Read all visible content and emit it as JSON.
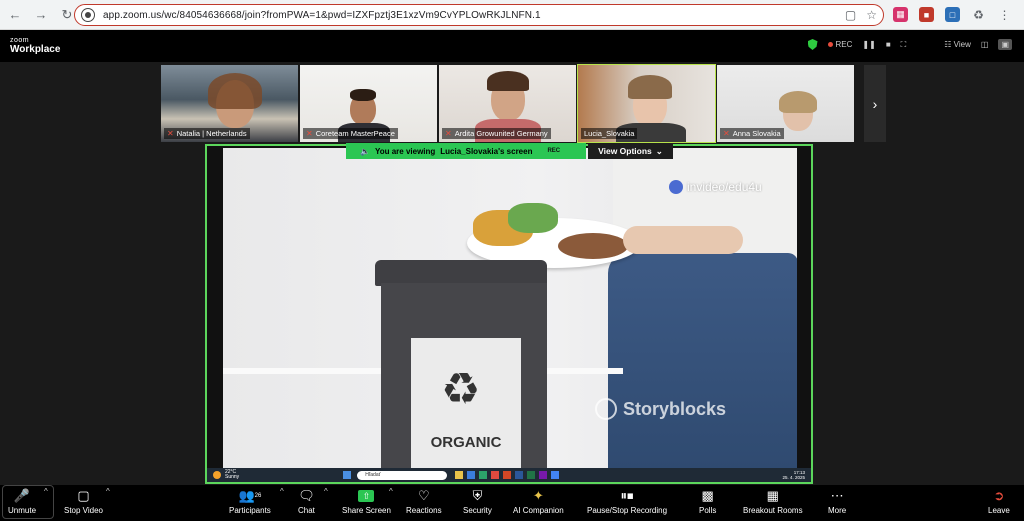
{
  "browser": {
    "url": "app.zoom.us/wc/84054636668/join?fromPWA=1&pwd=IZXFpztj3E1xzVm9CvYPLOwRKJLNFN.1"
  },
  "zoom": {
    "logo_small": "zoom",
    "logo_big": "Workplace",
    "rec_label": "REC",
    "view_label": "View"
  },
  "participants": [
    {
      "name": "Natalia | Netherlands"
    },
    {
      "name": "Coreteam MasterPeace"
    },
    {
      "name": "Ardita Growunited Germany"
    },
    {
      "name": "Lucia_Slovakia"
    },
    {
      "name": "Anna Slovakia"
    }
  ],
  "share": {
    "viewing_prefix": "You are viewing",
    "viewing_name": "Lucia_Slovakia's screen",
    "rec": "REC",
    "view_options": "View Options",
    "watermark_top": "invideo/edu4u",
    "watermark_bottom": "Storyblocks",
    "bin_label": "ORGANIC",
    "taskbar_weather_temp": "22°C",
    "taskbar_weather_text": "Sunny",
    "taskbar_search": "Hľadať",
    "taskbar_time": "17:13",
    "taskbar_date": "25. 4. 2025"
  },
  "toolbar": {
    "unmute": "Unmute",
    "stop_video": "Stop Video",
    "participants": "Participants",
    "participants_count": "26",
    "chat": "Chat",
    "share_screen": "Share Screen",
    "reactions": "Reactions",
    "security": "Security",
    "ai_companion": "AI Companion",
    "pause_stop": "Pause/Stop Recording",
    "polls": "Polls",
    "breakout": "Breakout Rooms",
    "more": "More",
    "leave": "Leave"
  },
  "colors": {
    "accent_green": "#2bc653",
    "active_border": "#b7e24a",
    "leave_red": "#e74c3c"
  }
}
